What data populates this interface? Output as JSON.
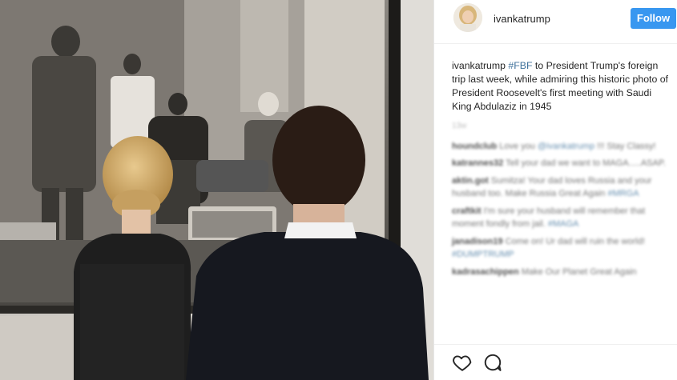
{
  "post": {
    "username": "ivankatrump",
    "follow_label": "Follow",
    "caption": {
      "username": "ivankatrump",
      "hashtag": "#FBF",
      "text": " to President Trump's foreign trip last week, while admiring this historic photo of President Roosevelt's first meeting with Saudi King Abdulaziz in 1945"
    },
    "time_ago": "13w",
    "comments": [
      {
        "user": "houndclub",
        "text": "Love you ",
        "tag": "@ivankatrump",
        "tail": " !!! Stay Classy!"
      },
      {
        "user": "katrannes32",
        "text": "Tell your dad we want to MAGA.....ASAP.",
        "tag": "",
        "tail": ""
      },
      {
        "user": "aktin.got",
        "text": "Sumitza! Your dad loves Russia and your husband too. Make Russia Great Again ",
        "tag": "#MRGA",
        "tail": ""
      },
      {
        "user": "craftkit",
        "text": "I'm sure your husband will remember that moment fondly from jail. ",
        "tag": "#MAGA",
        "tail": ""
      },
      {
        "user": "janadison19",
        "text": "Come on! Ur dad will ruin the world! ",
        "tag": "#DUMPTRUMP",
        "tail": ""
      },
      {
        "user": "kadrasachippen",
        "text": "Make Our Planet Great Again",
        "tag": "",
        "tail": ""
      }
    ]
  },
  "icons": {
    "like": "heart-icon",
    "comment": "comment-icon"
  },
  "colors": {
    "follow_button": "#3897f0",
    "hashtag": "#3f729b",
    "text": "#262626"
  }
}
